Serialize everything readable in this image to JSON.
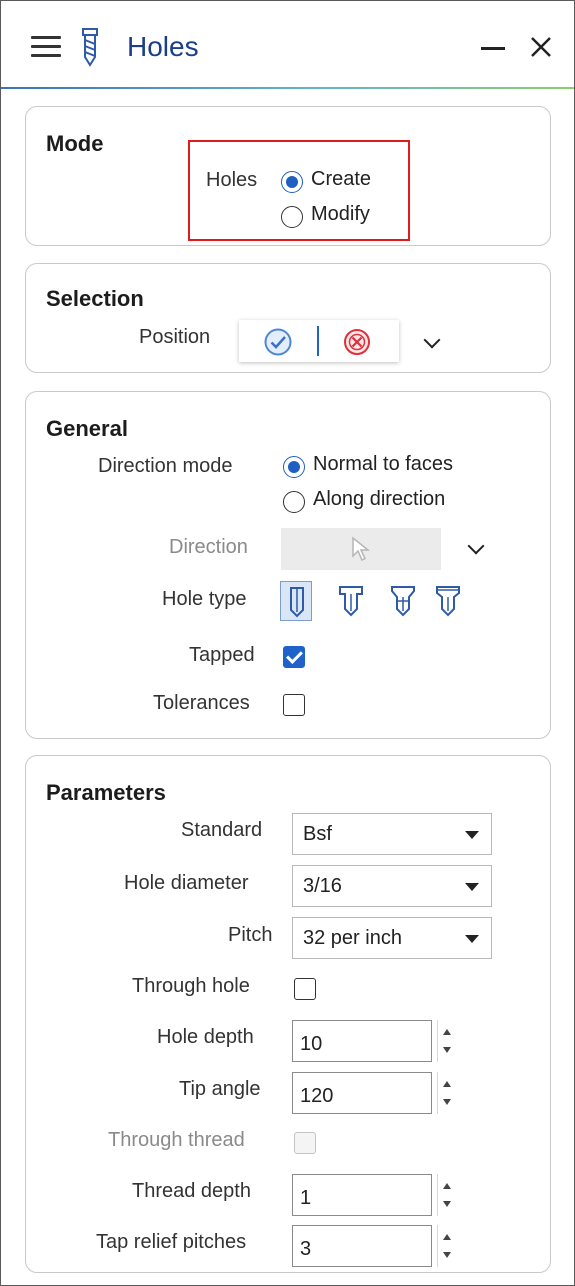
{
  "window": {
    "title": "Holes",
    "icons": {
      "menu": "hamburger-menu-icon",
      "app": "drill-icon",
      "minimize": "minimize-icon",
      "close": "close-icon"
    }
  },
  "mode": {
    "heading": "Mode",
    "holes_label": "Holes",
    "options": [
      {
        "label": "Create",
        "selected": true
      },
      {
        "label": "Modify",
        "selected": false
      }
    ]
  },
  "selection": {
    "heading": "Selection",
    "position_label": "Position",
    "buttons": {
      "accept": "checkmark-circle-icon",
      "clear": "clear-x-circle-icon"
    }
  },
  "general": {
    "heading": "General",
    "direction_mode_label": "Direction mode",
    "direction_mode_options": [
      {
        "label": "Normal to faces",
        "selected": true
      },
      {
        "label": "Along direction",
        "selected": false
      }
    ],
    "direction_label": "Direction",
    "hole_type_label": "Hole type",
    "hole_types": [
      "simple-hole-icon",
      "counterbore-hole-icon",
      "countersink-hole-icon",
      "counterdrill-hole-icon"
    ],
    "hole_type_selected": 0,
    "tapped_label": "Tapped",
    "tapped": true,
    "tolerances_label": "Tolerances",
    "tolerances": false
  },
  "parameters": {
    "heading": "Parameters",
    "standard_label": "Standard",
    "standard_value": "Bsf",
    "hole_diameter_label": "Hole diameter",
    "hole_diameter_value": "3/16",
    "pitch_label": "Pitch",
    "pitch_value": "32 per inch",
    "through_hole_label": "Through hole",
    "through_hole": false,
    "hole_depth_label": "Hole depth",
    "hole_depth_value": "10",
    "tip_angle_label": "Tip angle",
    "tip_angle_value": "120",
    "through_thread_label": "Through thread",
    "through_thread": false,
    "thread_depth_label": "Thread depth",
    "thread_depth_value": "1",
    "tap_relief_label": "Tap relief pitches",
    "tap_relief_value": "3"
  },
  "colors": {
    "title": "#1a3f86",
    "accent_blue": "#1f62c9",
    "highlight_red": "#e01b1b",
    "clear_red": "#e0303a"
  }
}
